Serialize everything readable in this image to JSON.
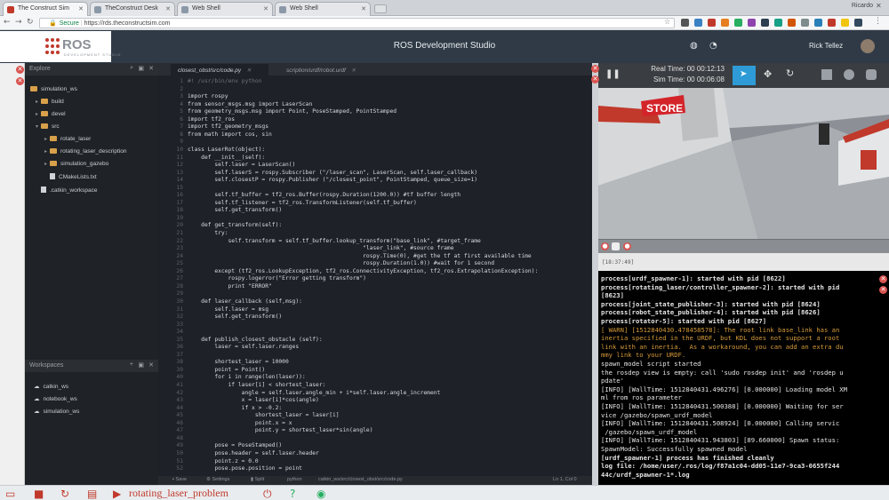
{
  "browser": {
    "tabs": [
      {
        "title": "The Construct Sim"
      },
      {
        "title": "TheConstruct Desk"
      },
      {
        "title": "Web Shell"
      },
      {
        "title": "Web Shell"
      }
    ],
    "user": "Ricardo",
    "secure_label": "Secure",
    "url": "https://rds.theconstructsim.com"
  },
  "app": {
    "logo_text": "ROS",
    "logo_sub": "DEVELOPMENT STUDIO",
    "title": "ROS Development Studio",
    "user_name": "Rick Tellez"
  },
  "explorer": {
    "header": "Explore",
    "items": [
      {
        "label": "simulation_ws",
        "type": "folder"
      },
      {
        "label": "build",
        "type": "folder"
      },
      {
        "label": "devel",
        "type": "folder"
      },
      {
        "label": "src",
        "type": "folder"
      },
      {
        "label": "rotate_laser",
        "type": "folder"
      },
      {
        "label": "rotating_laser_description",
        "type": "folder"
      },
      {
        "label": "simulation_gazebo",
        "type": "folder"
      },
      {
        "label": "CMakeLists.txt",
        "type": "file"
      },
      {
        "label": ".catkin_workspace",
        "type": "file"
      }
    ],
    "workspaces_header": "Workspaces",
    "workspaces": [
      "catkin_ws",
      "notebook_ws",
      "simulation_ws"
    ]
  },
  "editor": {
    "tabs": [
      {
        "label": "closest_obst/src/code.py"
      },
      {
        "label": "scription/urdf/robot.urdf"
      }
    ],
    "lines": [
      "#! /usr/bin/env python",
      "",
      "import rospy",
      "from sensor_msgs.msg import LaserScan",
      "from geometry_msgs.msg import Point, PoseStamped, PointStamped",
      "import tf2_ros",
      "import tf2_geometry_msgs",
      "from math import cos, sin",
      "",
      "class LaserRot(object):",
      "    def __init__(self):",
      "        self.laser = LaserScan()",
      "        self.laserS = rospy.Subscriber (\"/laser_scan\", LaserScan, self.laser_callback)",
      "        self.closestP = rospy.Publisher (\"/closest_point\", PointStamped, queue_size=1)",
      "",
      "        self.tf_buffer = tf2_ros.Buffer(rospy.Duration(1200.0)) #tf buffer length",
      "        self.tf_listener = tf2_ros.TransformListener(self.tf_buffer)",
      "        self.get_transform()",
      "",
      "    def get_transform(self):",
      "        try:",
      "            self.transform = self.tf_buffer.lookup_transform(\"base_link\", #target_frame",
      "                                                    \"laser_link\", #source frame",
      "                                                    rospy.Time(0), #get the tf at first available time",
      "                                                    rospy.Duration(1.0)) #wait for 1 second",
      "        except (tf2_ros.LookupException, tf2_ros.ConnectivityException, tf2_ros.ExtrapolationException):",
      "            rospy.logerror(\"Error getting transform\")",
      "            print \"ERROR\"",
      "",
      "    def laser_callback (self,msg):",
      "        self.laser = msg",
      "        self.get_transform()",
      "",
      "",
      "    def publish_closest_obstacle (self):",
      "        laser = self.laser.ranges",
      "",
      "        shortest_laser = 10000",
      "        point = Point()",
      "        for i in range(len(laser)):",
      "            if laser[i] < shortest_laser:",
      "                angle = self.laser.angle_min + i*self.laser.angle_increment",
      "                x = laser[i]*cos(angle)",
      "                if x > -0.2:",
      "                    shortest_laser = laser[i]",
      "                    point.x = x",
      "                    point.y = shortest_laser*sin(angle)",
      "",
      "        pose = PoseStamped()",
      "        pose.header = self.laser.header",
      "        point.z = 0.0",
      "        pose.pose.position = point"
    ],
    "status": {
      "save": "Save",
      "settings": "Settings",
      "split": "Split",
      "language": "python",
      "path": "catkin_ws/src/closest_obst/src/code.py",
      "position": "Ln 1, Col 0"
    }
  },
  "gazebo": {
    "real_time_label": "Real Time:",
    "real_time": "00 00:12:13",
    "sim_time_label": "Sim Time:",
    "sim_time": "00 00:06:08",
    "store_sign": "STORE",
    "log_timestamp": "[18:37:49]"
  },
  "terminal": {
    "lines": [
      {
        "text": "process[urdf_spawner-1]: started with pid [8622]",
        "kind": "b"
      },
      {
        "text": "process[rotating_laser/controller_spawner-2]: started with pid",
        "kind": "b"
      },
      {
        "text": "[8623]",
        "kind": "b"
      },
      {
        "text": "process[joint_state_publisher-3]: started with pid [8624]",
        "kind": "b"
      },
      {
        "text": "process[robot_state_publisher-4]: started with pid [8626]",
        "kind": "b"
      },
      {
        "text": "process[rotator-5]: started with pid [8627]",
        "kind": "b"
      },
      {
        "text": "[ WARN] [1512840430.478458578]: The root link base_link has an",
        "kind": "w"
      },
      {
        "text": "inertia specified in the URDF, but KDL does not support a root",
        "kind": "w"
      },
      {
        "text": "link with an inertia.  As a workaround, you can add an extra du",
        "kind": "w"
      },
      {
        "text": "mmy link to your URDF.",
        "kind": "w"
      },
      {
        "text": "spawn_model script started",
        "kind": "n"
      },
      {
        "text": "the rosdep view is empty: call 'sudo rosdep init' and 'rosdep u",
        "kind": "n"
      },
      {
        "text": "pdate'",
        "kind": "n"
      },
      {
        "text": "[INFO] [WallTime: 1512840431.496276] [0.000000] Loading model XM",
        "kind": "n"
      },
      {
        "text": "ml from ros parameter",
        "kind": "n"
      },
      {
        "text": "[INFO] [WallTime: 1512840431.500388] [0.000000] Waiting for ser",
        "kind": "n"
      },
      {
        "text": "vice /gazebo/spawn_urdf_model",
        "kind": "n"
      },
      {
        "text": "[INFO] [WallTime: 1512840431.508924] [0.000000] Calling servic",
        "kind": "n"
      },
      {
        "text": " /gazebo/spawn_urdf_model",
        "kind": "n"
      },
      {
        "text": "[INFO] [WallTime: 1512840431.943803] [89.660000] Spawn status:",
        "kind": "n"
      },
      {
        "text": "SpawnModel: Successfully spawned model",
        "kind": "n"
      },
      {
        "text": "[urdf_spawner-1] process has finished cleanly",
        "kind": "b"
      },
      {
        "text": "log file: /home/user/.ros/log/f87a1c04-dd05-11e7-9ca3-0655f244",
        "kind": "b"
      },
      {
        "text": "44c/urdf_spawner-1*.log",
        "kind": "b"
      }
    ]
  },
  "bottom": {
    "problem_name": "rotating_laser_problem"
  },
  "colors": {
    "app_header": "#2f3a46",
    "accent_red": "#c0392b",
    "explorer_bg": "#1f2226",
    "editor_bg": "#1e2127",
    "terminal_bg": "#000000"
  }
}
